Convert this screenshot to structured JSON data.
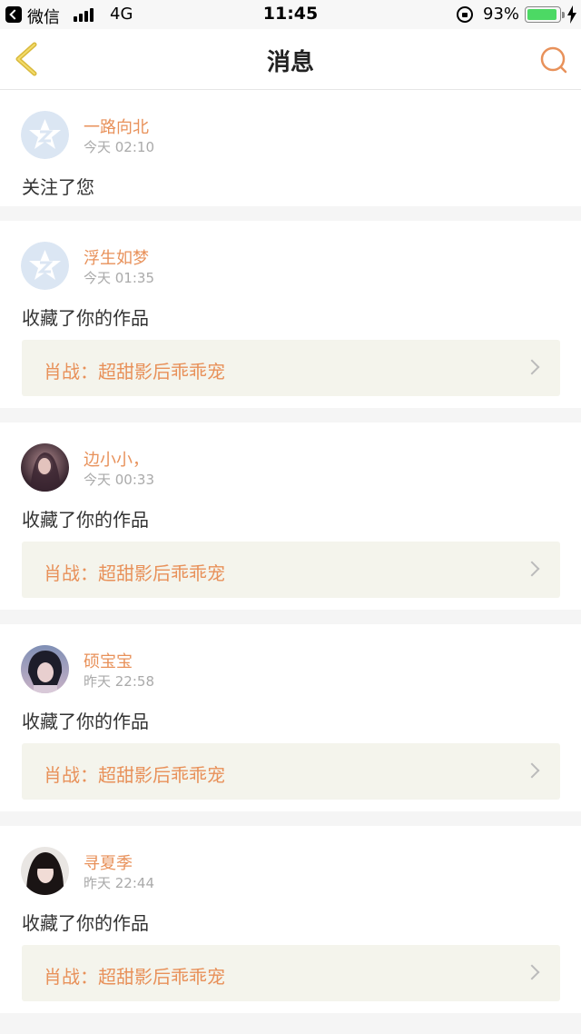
{
  "status_bar": {
    "back_app": "微信",
    "network": "4G",
    "time": "11:45",
    "battery_pct": "93%"
  },
  "nav": {
    "title": "消息",
    "back_icon": "chevron-left-icon",
    "search_icon": "search-icon"
  },
  "colors": {
    "accent": "#e8915a",
    "back_icon": "#e8c84a",
    "work_bg": "#f4f4ec"
  },
  "messages": [
    {
      "user": "一路向北",
      "time": "今天 02:10",
      "action": "关注了您",
      "avatar": "default-star"
    },
    {
      "user": "浮生如梦",
      "time": "今天 01:35",
      "action": "收藏了你的作品",
      "work": "肖战：超甜影后乖乖宠",
      "avatar": "default-star"
    },
    {
      "user": "边小小，",
      "time": "今天 00:33",
      "action": "收藏了你的作品",
      "work": "肖战：超甜影后乖乖宠",
      "avatar": "photo"
    },
    {
      "user": "硕宝宝",
      "time": "昨天 22:58",
      "action": "收藏了你的作品",
      "work": "肖战：超甜影后乖乖宠",
      "avatar": "photo"
    },
    {
      "user": "寻夏季",
      "time": "昨天 22:44",
      "action": "收藏了你的作品",
      "work": "肖战：超甜影后乖乖宠",
      "avatar": "photo"
    }
  ]
}
